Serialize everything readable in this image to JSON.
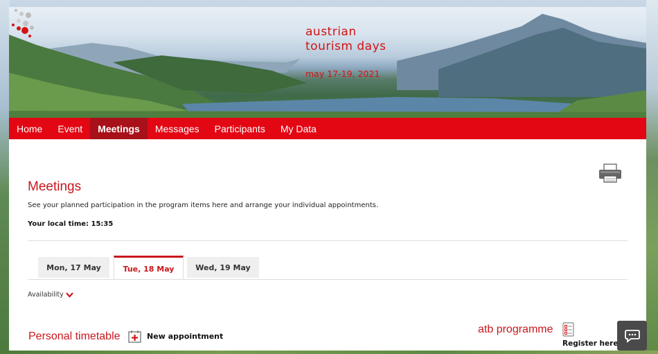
{
  "header": {
    "logo_line1": "austrian",
    "logo_line2": "tourism days",
    "date": "may 17-19, 2021"
  },
  "nav": {
    "items": [
      {
        "label": "Home",
        "active": false
      },
      {
        "label": "Event",
        "active": false
      },
      {
        "label": "Meetings",
        "active": true
      },
      {
        "label": "Messages",
        "active": false
      },
      {
        "label": "Participants",
        "active": false
      },
      {
        "label": "My Data",
        "active": false
      }
    ]
  },
  "main": {
    "title": "Meetings",
    "description": "See your planned participation in the program items here and arrange your individual appointments.",
    "local_time": "Your local time: 15:35",
    "tabs": [
      {
        "label": "Mon, 17 May",
        "active": false
      },
      {
        "label": "Tue, 18 May",
        "active": true
      },
      {
        "label": "Wed, 19 May",
        "active": false
      }
    ],
    "availability_label": "Availability",
    "timetable_title": "Personal timetable",
    "new_appointment_label": "New appointment",
    "atb_title": "atb programme",
    "register_label": "Register here"
  },
  "icons": {
    "print": "printer-icon",
    "new_appointment": "calendar-plus-icon",
    "atb": "checklist-icon",
    "chat": "chat-icon",
    "availability": "chevron-down-icon"
  },
  "colors": {
    "brand_red": "#e30613",
    "nav_active": "#a8101a",
    "heading_red": "#c8171e",
    "chat_button": "#4a4a4a"
  }
}
